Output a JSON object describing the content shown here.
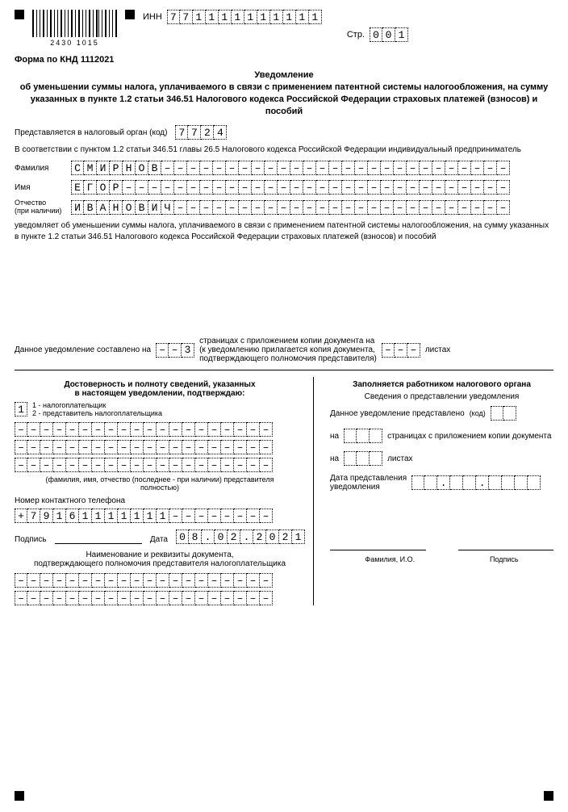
{
  "inn_label": "ИНН",
  "inn": [
    "7",
    "7",
    "1",
    "1",
    "1",
    "1",
    "1",
    "1",
    "1",
    "1",
    "1",
    "1"
  ],
  "page_label": "Стр.",
  "page": [
    "0",
    "0",
    "1"
  ],
  "barcode_nums": "2430   1015",
  "form_code": "Форма по КНД 1112021",
  "title": "Уведомление\nоб уменьшении суммы налога, уплачиваемого в связи с применением патентной системы налогообложения, на сумму указанных в пункте 1.2 статьи 346.51 Налогового кодекса Российской Федерации страховых платежей (взносов) и пособий",
  "tax_auth_label": "Представляется в налоговый орган (код)",
  "tax_auth": [
    "7",
    "7",
    "2",
    "4"
  ],
  "preamble": "В соответствии с пунктом 1.2 статьи 346.51 главы 26.5 Налогового кодекса Российской Федерации индивидуальный предприниматель",
  "surname_label": "Фамилия",
  "surname": [
    "С",
    "М",
    "И",
    "Р",
    "Н",
    "О",
    "В"
  ],
  "name_label": "Имя",
  "name": [
    "Е",
    "Г",
    "О",
    "Р"
  ],
  "patr_label": "Отчество",
  "patr_note": "(при наличии)",
  "patr": [
    "И",
    "В",
    "А",
    "Н",
    "О",
    "В",
    "И",
    "Ч"
  ],
  "declares": "уведомляет об уменьшении суммы налога, уплачиваемого в связи с применением патентной системы налогообложения, на сумму указанных в пункте 1.2 статьи 346.51 Налогового кодекса Российской Федерации страховых платежей (взносов) и пособий",
  "pages_block": {
    "a": "Данное уведомление составлено на",
    "pages": [
      "",
      "",
      "3"
    ],
    "b": "страницах с приложением копии документа на\n(к уведомлению прилагается копия документа,\nподтверждающего полномочия представителя)",
    "sheets": [
      "",
      "",
      ""
    ],
    "c": "листах"
  },
  "left": {
    "h": "Достоверность и полноту сведений, указанных\nв настоящем уведомлении, подтверждаю:",
    "kind": [
      "1"
    ],
    "kind_opts": "1 - налогоплательщик\n2 - представитель налогоплательщика",
    "rep_note": "(фамилия, имя, отчество (последнее - при наличии) представителя\nполностью)",
    "phone_label": "Номер контактного телефона",
    "phone": [
      "+",
      "7",
      "9",
      "1",
      "6",
      "1",
      "1",
      "1",
      "1",
      "1",
      "1",
      "1"
    ],
    "sign": "Подпись",
    "date_label": "Дата",
    "date": [
      "0",
      "8",
      ".",
      "0",
      "2",
      ".",
      "2",
      "0",
      "2",
      "1"
    ],
    "doc_h": "Наименование и реквизиты документа,\nподтверждающего полномочия представителя налогоплательщика"
  },
  "right": {
    "h": "Заполняется работником налогового органа",
    "sub": "Сведения о представлении уведомления",
    "a": "Данное уведомление представлено",
    "code": "(код)",
    "b": "на",
    "b2": "страницах с приложением копии документа",
    "c": "на",
    "c2": "листах",
    "d": "Дата представления\nуведомления",
    "fio": "Фамилия, И.О.",
    "sign": "Подпись"
  }
}
